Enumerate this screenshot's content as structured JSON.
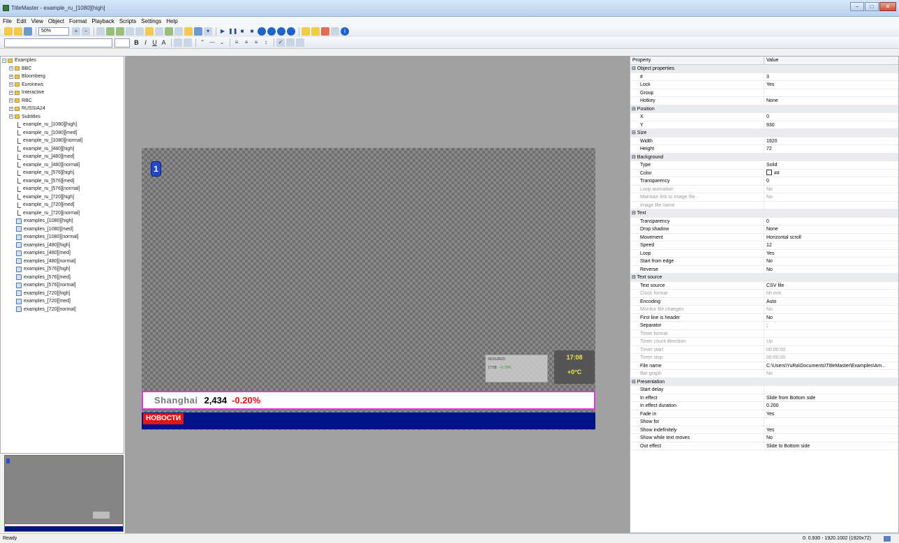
{
  "window": {
    "title": "TitleMaster - example_ru_[1080][high]",
    "controls": {
      "minimize": "–",
      "maximize": "□",
      "close": "✕"
    }
  },
  "menu": [
    "File",
    "Edit",
    "View",
    "Object",
    "Format",
    "Playback",
    "Scripts",
    "Settings",
    "Help"
  ],
  "toolbar": {
    "zoom": "50%",
    "format_buttons": {
      "bold": "B",
      "italic": "I",
      "underline": "U",
      "text": "A"
    }
  },
  "tree": {
    "root": "Examples",
    "folders": [
      "BBC",
      "Bloomberg",
      "Euronews",
      "Interactive",
      "RBC",
      "RUSSIA24",
      "Subtitles"
    ],
    "scripts": [
      "example_ru_[1080][high]",
      "example_ru_[1080][med]",
      "example_ru_[1080][normal]",
      "example_ru_[480][high]",
      "example_ru_[480][med]",
      "example_ru_[480][normal]",
      "example_ru_[576][high]",
      "example_ru_[576][med]",
      "example_ru_[576][normal]",
      "example_ru_[720][high]",
      "example_ru_[720][med]",
      "example_ru_[720][normal]"
    ],
    "documents": [
      "examples_[1080][high]",
      "examples_[1080][med]",
      "examples_[1080][normal]",
      "examples_[480][high]",
      "examples_[480][med]",
      "examples_[480][normal]",
      "examples_[576][high]",
      "examples_[576][med]",
      "examples_[576][normal]",
      "examples_[720][high]",
      "examples_[720][med]",
      "examples_[720][normal]"
    ]
  },
  "canvas": {
    "logo_char": "1",
    "info_widget": {
      "line1": "05/11/2020",
      "line2a": "17:58",
      "line2b": "+0.28%"
    },
    "clock": {
      "time": "17:08",
      "temp": "+0°C"
    },
    "ticker": {
      "city": "Shanghai",
      "price": "2,434",
      "change": "-0.20%"
    },
    "news_badge": "НОВОСТИ"
  },
  "properties": {
    "header": {
      "property": "Property",
      "value": "Value"
    },
    "rows": [
      {
        "cat": true,
        "name": "⊟ Object properties"
      },
      {
        "name": "#",
        "value": "3"
      },
      {
        "name": "Lock",
        "value": "Yes"
      },
      {
        "name": "Group",
        "value": ""
      },
      {
        "name": "Hotkey",
        "value": "None"
      },
      {
        "cat": true,
        "name": "⊟ Position"
      },
      {
        "name": "X",
        "value": "0"
      },
      {
        "name": "Y",
        "value": "930"
      },
      {
        "cat": true,
        "name": "⊟ Size"
      },
      {
        "name": "Width",
        "value": "1920"
      },
      {
        "name": "Height",
        "value": "72"
      },
      {
        "cat": true,
        "name": "⊟ Background"
      },
      {
        "name": "Type",
        "value": "Solid"
      },
      {
        "name": "Color",
        "value": "##",
        "swatch": true
      },
      {
        "name": "Transparency",
        "value": "0"
      },
      {
        "name": "Loop animation",
        "value": "No",
        "dis": true
      },
      {
        "name": "Maintain link to image file",
        "value": "No",
        "dis": true
      },
      {
        "name": "Image file name",
        "value": "",
        "dis": true
      },
      {
        "cat": true,
        "name": "⊟ Text"
      },
      {
        "name": "Transparency",
        "value": "0"
      },
      {
        "name": "Drop shadow",
        "value": "None"
      },
      {
        "name": "Movement",
        "value": "Horizontal scroll"
      },
      {
        "name": "Speed",
        "value": "12"
      },
      {
        "name": "Loop",
        "value": "Yes"
      },
      {
        "name": "Start from edge",
        "value": "No"
      },
      {
        "name": "Reverse",
        "value": "No"
      },
      {
        "cat": true,
        "name": "⊟ Text source"
      },
      {
        "name": "Text source",
        "value": "CSV file"
      },
      {
        "name": "Clock format",
        "value": "hh:mm",
        "dis": true
      },
      {
        "name": "Encoding",
        "value": "Auto"
      },
      {
        "name": "Monitor file changes",
        "value": "No",
        "dis": true
      },
      {
        "name": "First line is header",
        "value": "No"
      },
      {
        "name": "Separator",
        "value": ";"
      },
      {
        "name": "Timer format",
        "value": "",
        "dis": true
      },
      {
        "name": "Timer count direction",
        "value": "Up",
        "dis": true
      },
      {
        "name": "Timer start",
        "value": "00:00:00",
        "dis": true
      },
      {
        "name": "Timer stop",
        "value": "00:00:00",
        "dis": true
      },
      {
        "name": "File name",
        "value": "C:\\Users\\YuRa\\Documents\\TitleMaster\\Examples\\Am..."
      },
      {
        "name": "Bar graph",
        "value": "No",
        "dis": true
      },
      {
        "cat": true,
        "name": "⊟ Presentation"
      },
      {
        "name": "Start delay",
        "value": ""
      },
      {
        "name": "In effect",
        "value": "Slide from Bottom side"
      },
      {
        "name": "In effect duration",
        "value": "0.200"
      },
      {
        "name": "Fade in",
        "value": "Yes"
      },
      {
        "name": "Show for",
        "value": ""
      },
      {
        "name": "Show indefinitely",
        "value": "Yes"
      },
      {
        "name": "Show while text moves",
        "value": "No"
      },
      {
        "name": "Out effect",
        "value": "Slide to Bottom side"
      }
    ]
  },
  "status": {
    "left": "Ready",
    "right": "0: 0.930 - 1920.1002 (1920x72)"
  }
}
